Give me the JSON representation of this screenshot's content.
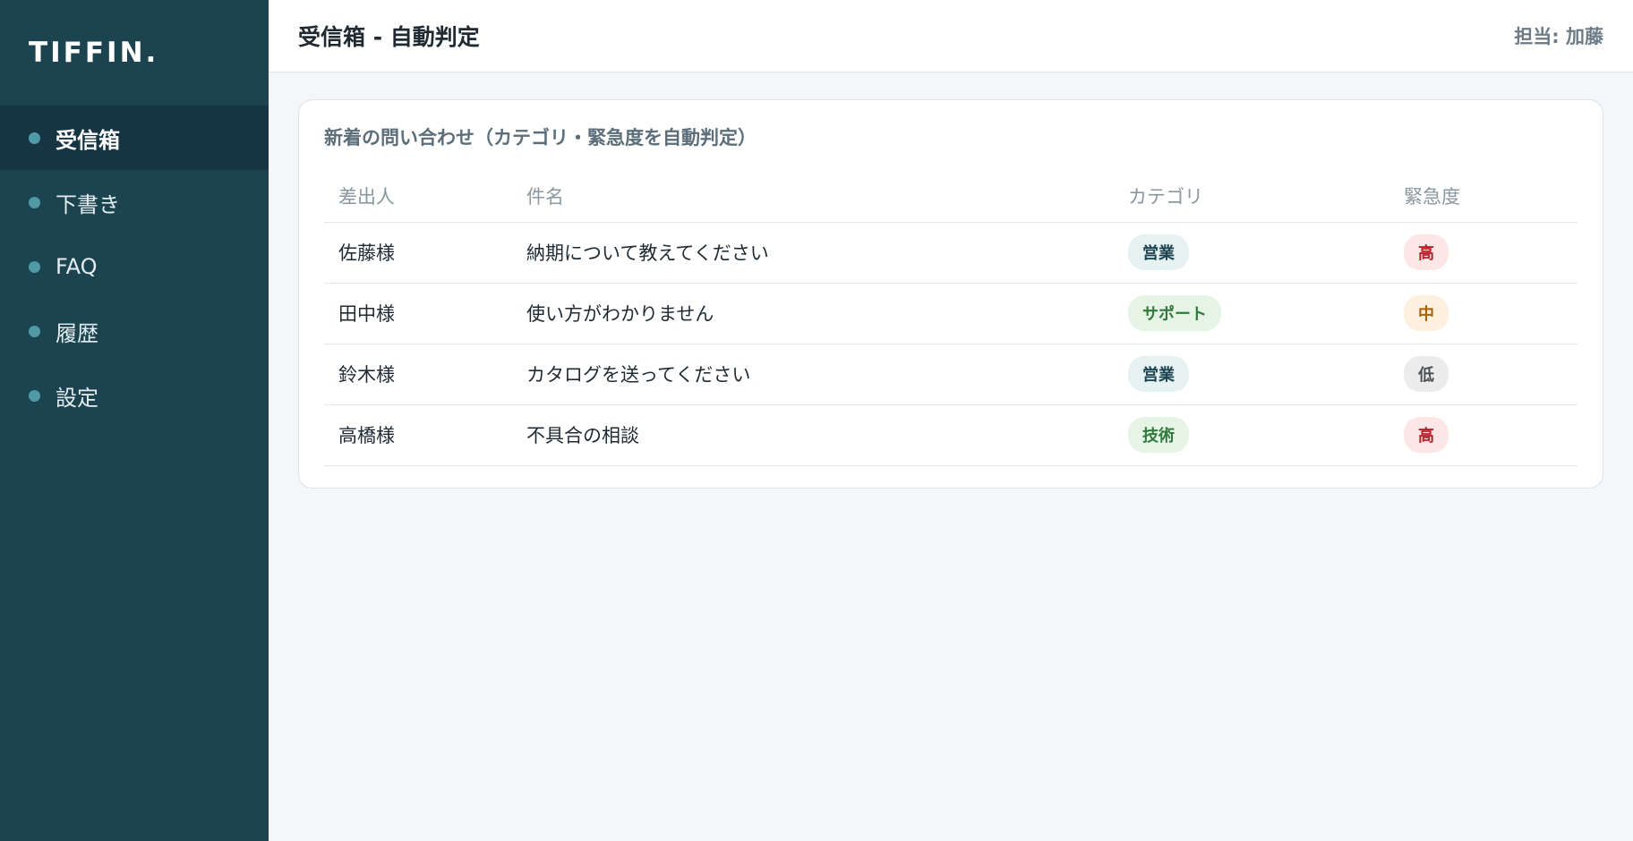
{
  "brand": "TIFFIN.",
  "sidebar": {
    "items": [
      {
        "label": "受信箱",
        "active": true
      },
      {
        "label": "下書き",
        "active": false
      },
      {
        "label": "FAQ",
        "active": false
      },
      {
        "label": "履歴",
        "active": false
      },
      {
        "label": "設定",
        "active": false
      }
    ]
  },
  "header": {
    "title": "受信箱 - 自動判定",
    "assignee": "担当: 加藤"
  },
  "card": {
    "title": "新着の問い合わせ（カテゴリ・緊急度を自動判定）",
    "columns": [
      "差出人",
      "件名",
      "カテゴリ",
      "緊急度"
    ],
    "rows": [
      {
        "sender": "佐藤様",
        "subject": "納期について教えてください",
        "category": "営業",
        "urgency": "高"
      },
      {
        "sender": "田中様",
        "subject": "使い方がわかりません",
        "category": "サポート",
        "urgency": "中"
      },
      {
        "sender": "鈴木様",
        "subject": "カタログを送ってください",
        "category": "営業",
        "urgency": "低"
      },
      {
        "sender": "高橋様",
        "subject": "不具合の相談",
        "category": "技術",
        "urgency": "高"
      }
    ]
  },
  "colors": {
    "sidebar_bg": "#1b4350",
    "sidebar_active_bg": "#153543",
    "urgency_high": "#b3242c",
    "urgency_mid": "#a8620c",
    "urgency_low": "#4a4f54",
    "category_green": "#2f7a3c"
  }
}
